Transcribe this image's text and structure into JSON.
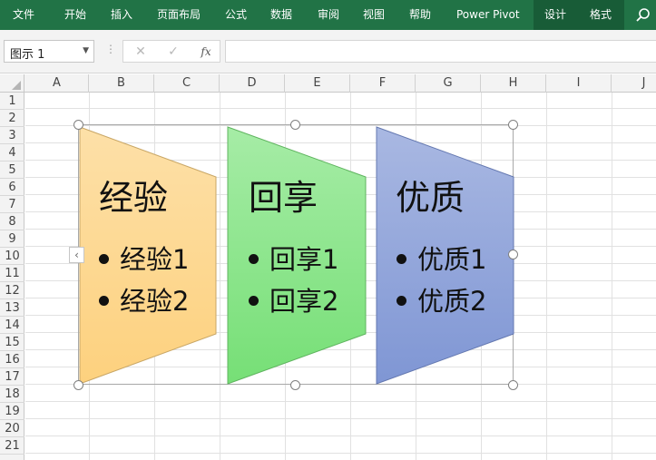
{
  "ribbon": {
    "tabs": [
      "文件",
      "开始",
      "插入",
      "页面布局",
      "公式",
      "数据",
      "审阅",
      "视图",
      "帮助",
      "Power Pivot",
      "设计",
      "格式"
    ],
    "context_tabs": [
      "设计",
      "格式"
    ],
    "background_color": "#217346",
    "context_tab_color": "#185c37",
    "search_icon": "search-icon"
  },
  "formula_bar": {
    "name_box_value": "图示 1",
    "cancel_glyph": "✕",
    "enter_glyph": "✓",
    "fx_glyph": "fx",
    "formula_value": ""
  },
  "grid": {
    "columns": [
      "A",
      "B",
      "C",
      "D",
      "E",
      "F",
      "G",
      "H",
      "I",
      "J"
    ],
    "rows": [
      "1",
      "2",
      "3",
      "4",
      "5",
      "6",
      "7",
      "8",
      "9",
      "10",
      "11",
      "12",
      "13",
      "14",
      "15",
      "16",
      "17",
      "18",
      "19",
      "20",
      "21"
    ]
  },
  "smartart": {
    "expander_glyph": "‹",
    "shapes": [
      {
        "title": "经验",
        "bullets": [
          "经验1",
          "经验2"
        ],
        "color_top": "#fde0a8",
        "color_bottom": "#fdd17e"
      },
      {
        "title": "回享",
        "bullets": [
          "回享1",
          "回享2"
        ],
        "color_top": "#a6eca6",
        "color_bottom": "#76df76"
      },
      {
        "title": "优质",
        "bullets": [
          "优质1",
          "优质2"
        ],
        "color_top": "#a9b8e2",
        "color_bottom": "#7f96d4"
      }
    ]
  }
}
